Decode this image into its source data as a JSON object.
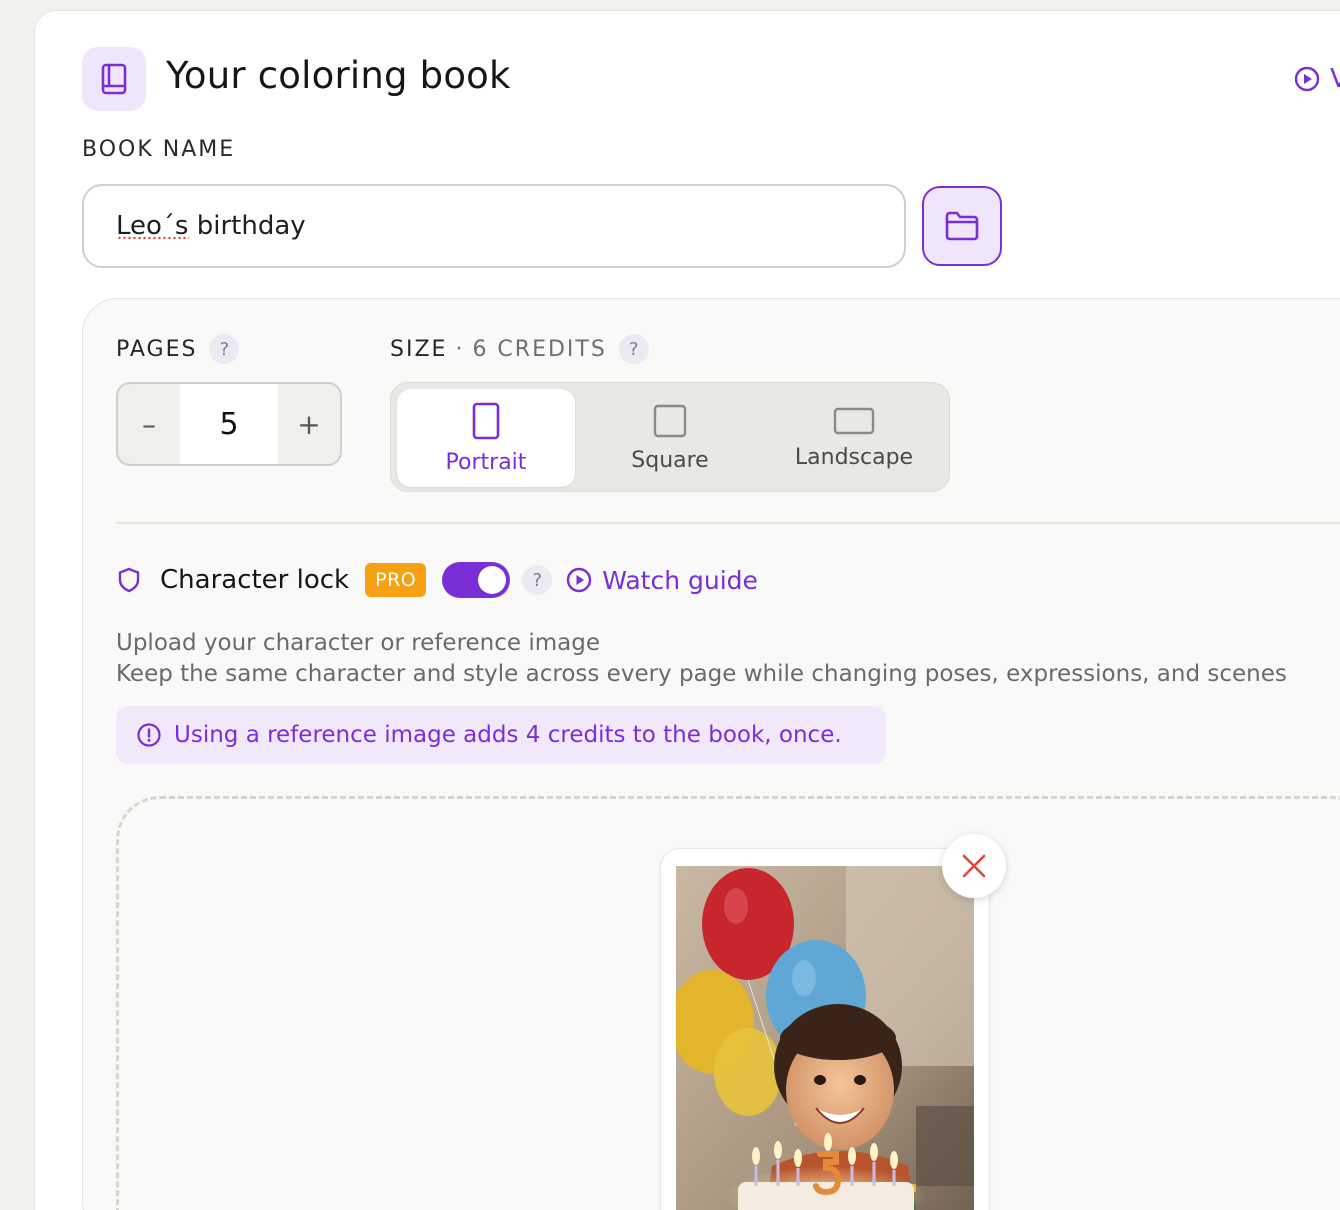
{
  "header": {
    "title": "Your coloring book",
    "video_link_label": "V"
  },
  "book_name": {
    "label": "BOOK NAME",
    "value": "Leo´s birthday"
  },
  "pages": {
    "label": "PAGES",
    "help": "?",
    "value": "5",
    "decrement": "–",
    "increment": "+"
  },
  "size": {
    "label": "SIZE",
    "separator": "·",
    "credits": "6 CREDITS",
    "help": "?",
    "options": [
      {
        "label": "Portrait",
        "selected": true
      },
      {
        "label": "Square",
        "selected": false
      },
      {
        "label": "Landscape",
        "selected": false
      }
    ]
  },
  "character_lock": {
    "title": "Character lock",
    "badge": "PRO",
    "enabled": true,
    "help": "?",
    "guide_label": "Watch guide",
    "description_line1": "Upload your character or reference image",
    "description_line2": "Keep the same character and style across every page while changing poses, expressions, and scenes",
    "notice": "Using a reference image adds 4 credits to the book, once."
  },
  "colors": {
    "accent": "#7a2fd6",
    "accent_bg": "#efe6fb",
    "pro_badge": "#f6a014",
    "remove_icon": "#e0453a"
  },
  "icons": {
    "header": "book-icon",
    "video": "play-circle-icon",
    "folder": "folder-icon",
    "lock": "shield-icon",
    "guide": "play-circle-icon",
    "notice": "info-circle-icon",
    "remove": "close-icon"
  }
}
